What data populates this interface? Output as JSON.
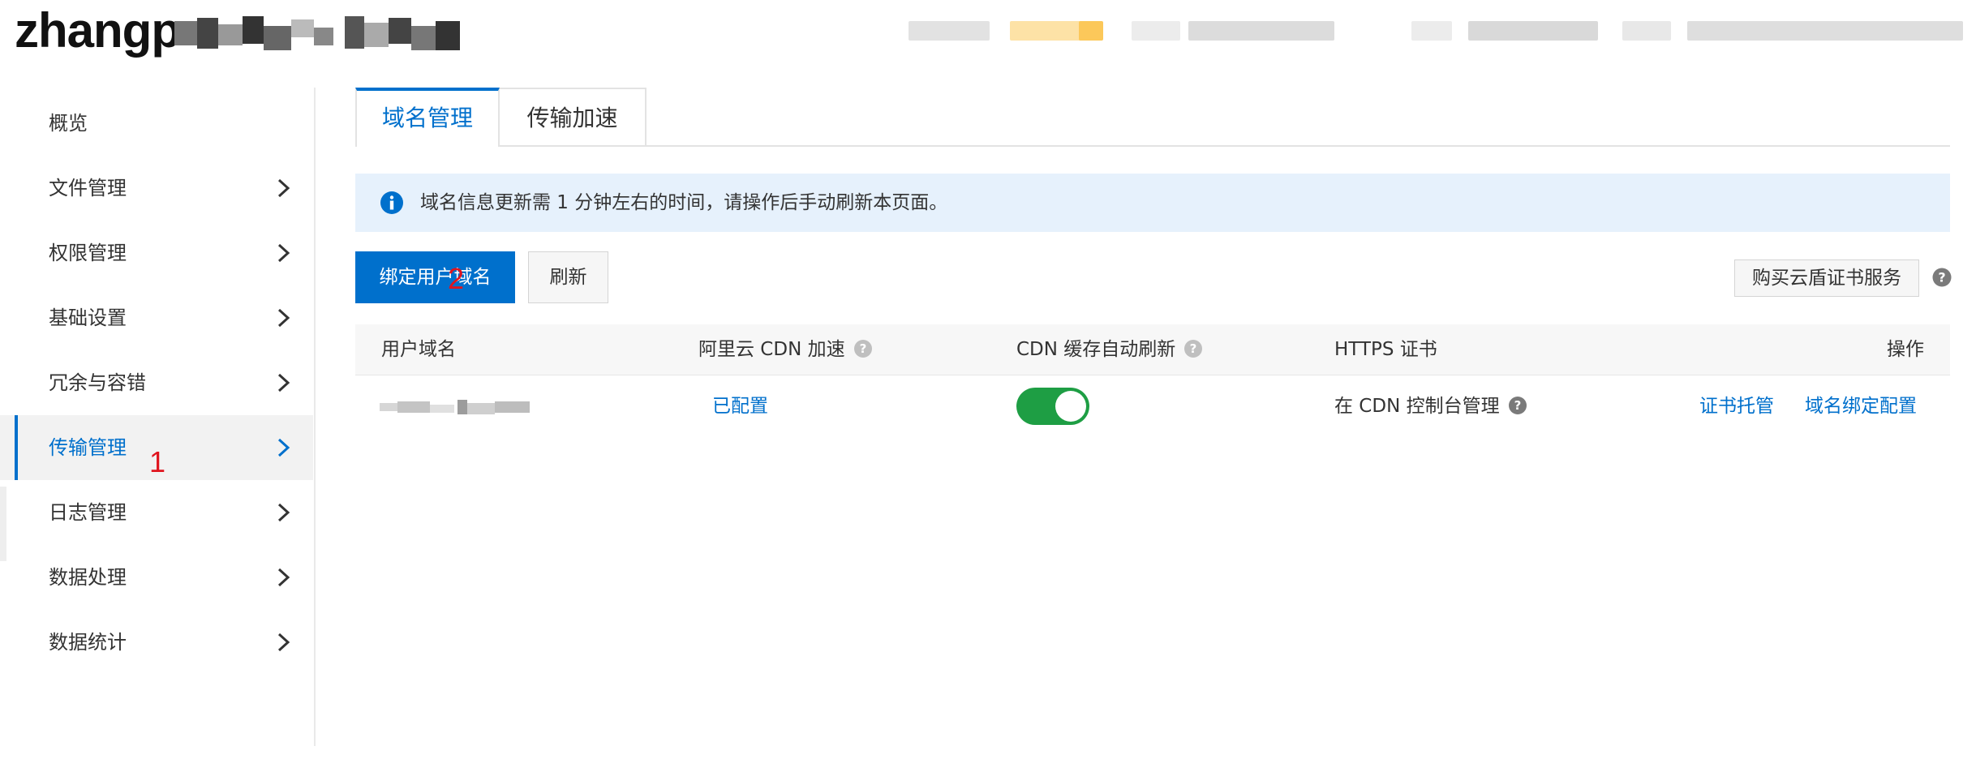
{
  "header": {
    "bucket_name_visible": "zhangp",
    "accent_color": "#0070cc"
  },
  "sidebar": {
    "items": [
      {
        "label": "概览",
        "has_arrow": false,
        "active": false
      },
      {
        "label": "文件管理",
        "has_arrow": true,
        "active": false
      },
      {
        "label": "权限管理",
        "has_arrow": true,
        "active": false
      },
      {
        "label": "基础设置",
        "has_arrow": true,
        "active": false
      },
      {
        "label": "冗余与容错",
        "has_arrow": true,
        "active": false
      },
      {
        "label": "传输管理",
        "has_arrow": true,
        "active": true
      },
      {
        "label": "日志管理",
        "has_arrow": true,
        "active": false
      },
      {
        "label": "数据处理",
        "has_arrow": true,
        "active": false
      },
      {
        "label": "数据统计",
        "has_arrow": true,
        "active": false
      }
    ]
  },
  "tabs": [
    {
      "label": "域名管理",
      "active": true
    },
    {
      "label": "传输加速",
      "active": false
    }
  ],
  "notice": {
    "icon": "info-icon",
    "text": "域名信息更新需 1 分钟左右的时间，请操作后手动刷新本页面。"
  },
  "toolbar": {
    "bind_domain_label": "绑定用户域名",
    "refresh_label": "刷新",
    "buy_cert_label": "购买云盾证书服务"
  },
  "annotations": {
    "marker_1": "1",
    "marker_2": "2"
  },
  "table": {
    "columns": [
      {
        "label": "用户域名",
        "help": false
      },
      {
        "label": "阿里云 CDN 加速",
        "help": true
      },
      {
        "label": "CDN 缓存自动刷新",
        "help": true
      },
      {
        "label": "HTTPS 证书",
        "help": false
      },
      {
        "label": "操作",
        "help": false
      }
    ],
    "rows": [
      {
        "cdn_status": "已配置",
        "auto_refresh_on": true,
        "https_cert": "在 CDN 控制台管理",
        "action_cert": "证书托管",
        "action_config": "域名绑定配置"
      }
    ]
  }
}
